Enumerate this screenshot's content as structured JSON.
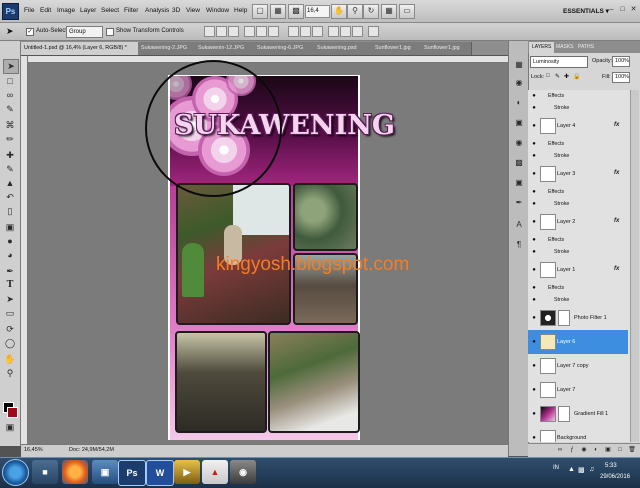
{
  "menubar": {
    "logo": "Ps",
    "items": [
      "File",
      "Edit",
      "Image",
      "Layer",
      "Select",
      "Filter",
      "Analysis",
      "3D",
      "View",
      "Window",
      "Help"
    ],
    "zoom": "16,4",
    "workspace": "ESSENTIALS ▾"
  },
  "options": {
    "auto_select_label": "Auto-Select:",
    "group_value": "Group",
    "show_transform": "Show Transform Controls"
  },
  "tabs": [
    {
      "label": "Untitled-1.psd @ 16,4% (Layer 6, RGB/8) *",
      "active": true
    },
    {
      "label": "Sukawening-2.JPG",
      "active": false
    },
    {
      "label": "Sukawenin-12.JPG",
      "active": false
    },
    {
      "label": "Sukawening-6.JPG",
      "active": false
    },
    {
      "label": "Sukawening.psd",
      "active": false
    },
    {
      "label": "Sunflower1.jpg",
      "active": false
    },
    {
      "label": "Sunflower1.jpg",
      "active": false
    }
  ],
  "canvas": {
    "title": "SUKAWENING",
    "watermark": "kingyosh.blogspot.com"
  },
  "status": {
    "zoom": "16,45%",
    "doc": "Doc: 24,9M/54,2M"
  },
  "panel": {
    "tabs": [
      "LAYERS",
      "MASKS",
      "PATHS"
    ],
    "blend": "Luminosity",
    "opacity_label": "Opacity:",
    "opacity": "100%",
    "lock_label": "Lock:",
    "fill_label": "Fill:",
    "fill": "100%"
  },
  "layers": [
    {
      "kind": "sub",
      "label": "Effects"
    },
    {
      "kind": "sub",
      "label": "Stroke"
    },
    {
      "kind": "layer",
      "label": "Layer 4",
      "fx": "fx"
    },
    {
      "kind": "sub",
      "label": "Effects"
    },
    {
      "kind": "sub",
      "label": "Stroke"
    },
    {
      "kind": "layer",
      "label": "Layer 3",
      "fx": "fx"
    },
    {
      "kind": "sub",
      "label": "Effects"
    },
    {
      "kind": "sub",
      "label": "Stroke"
    },
    {
      "kind": "layer",
      "label": "Layer 2",
      "fx": "fx"
    },
    {
      "kind": "sub",
      "label": "Effects"
    },
    {
      "kind": "sub",
      "label": "Stroke"
    },
    {
      "kind": "layer",
      "label": "Layer 1",
      "fx": "fx"
    },
    {
      "kind": "sub",
      "label": "Effects"
    },
    {
      "kind": "sub",
      "label": "Stroke"
    },
    {
      "kind": "layer",
      "label": "Photo Filter 1"
    },
    {
      "kind": "layer",
      "label": "Layer 6",
      "selected": true
    },
    {
      "kind": "layer",
      "label": "Layer 7 copy"
    },
    {
      "kind": "layer",
      "label": "Layer 7"
    },
    {
      "kind": "layer",
      "label": "Gradient Fill 1"
    },
    {
      "kind": "layer",
      "label": "Background"
    }
  ],
  "taskbar": {
    "apps": [
      "Ps",
      "W"
    ],
    "lang": "IN",
    "time": "5:33",
    "date": "29/06/2016"
  },
  "colors": {
    "accent": "#3d8ee0",
    "foreground": "#000000",
    "background": "#9c0c18",
    "watermark": "#f77d20"
  }
}
